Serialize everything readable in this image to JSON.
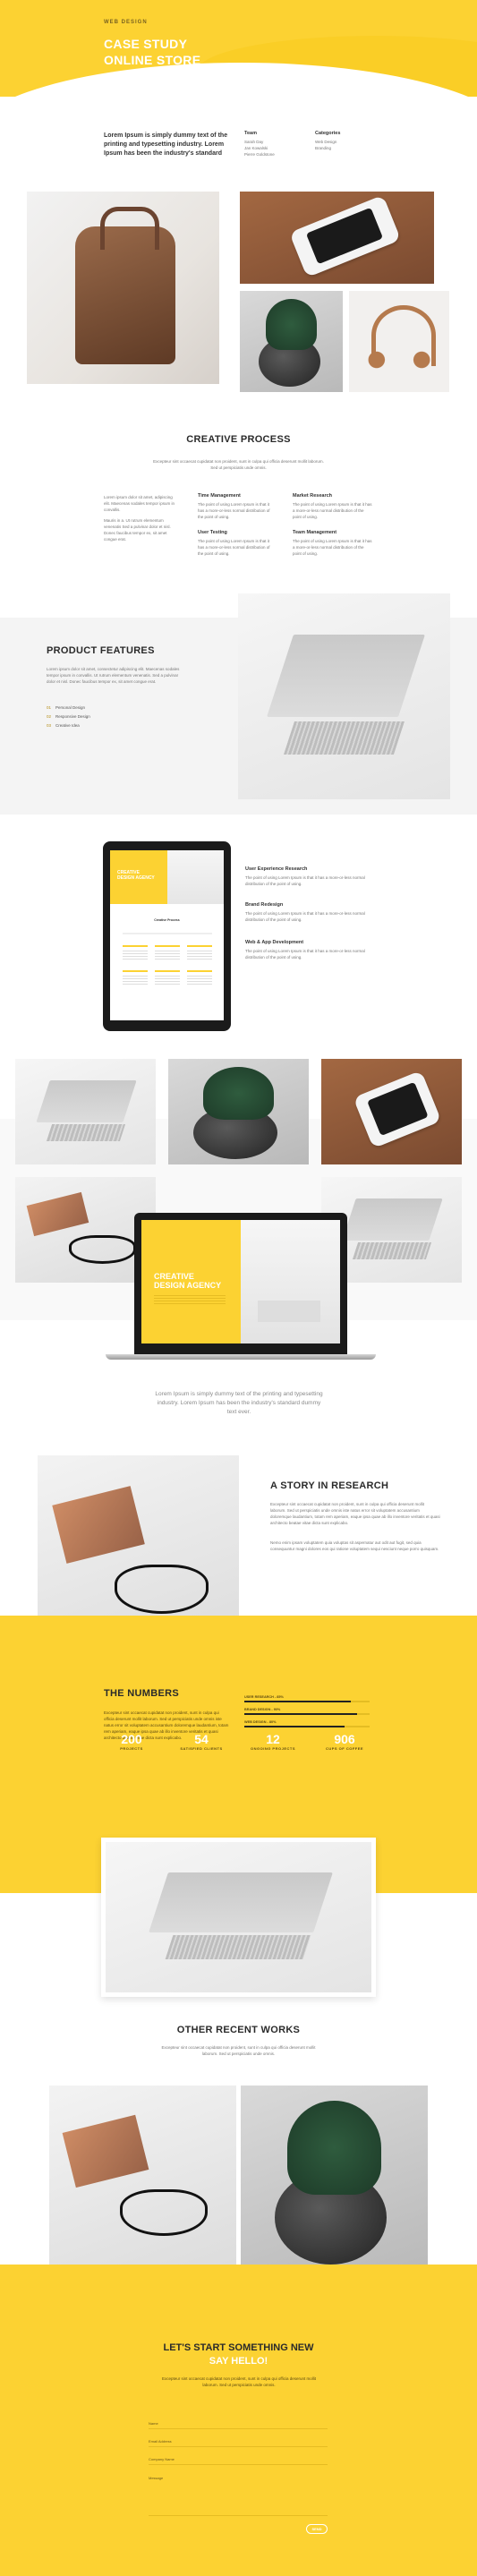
{
  "hero": {
    "eyebrow": "WEB DESIGN",
    "title_line1": "CASE STUDY",
    "title_line2": "ONLINE STORE"
  },
  "intro": {
    "lead": "Lorem Ipsum is simply dummy text of the printing and typesetting industry. Lorem Ipsum has been the industry's standard",
    "team_heading": "Team",
    "team_members": [
      "Sarah Day",
      "Jan Kowalski",
      "Pierre Goldstone"
    ],
    "categories_heading": "Categories",
    "categories": [
      "Web Design",
      "Branding"
    ]
  },
  "creative_process": {
    "title": "CREATIVE PROCESS",
    "subtitle": "Excepteur sint occaecat cupidatat non proident, sunt in culpa qui officia deserunt mollit laborum. Sed ut perspiciatis unde omnis.",
    "left_text_1": "Lorem ipsum dolor sit amet, adipiscing elit. Maecenas sodales tempor ipsum in convallis.",
    "left_text_2": "Mauris in a. Ut rutrum elementum venenatis Sed a pulvinar dolor et nisl. Donec faucibus tempor ex, sit amet congue erat.",
    "items": [
      {
        "title": "Time Management",
        "text": "The point of using Lorem Ipsum is that it has a more-or-less normal distribution of the point of using."
      },
      {
        "title": "Market Research",
        "text": "The point of using Lorem Ipsum is that it has a more-or-less normal distribution of the point of using."
      },
      {
        "title": "User Testing",
        "text": "The point of using Lorem Ipsum is that it has a more-or-less normal distribution of the point of using."
      },
      {
        "title": "Team Management",
        "text": "The point of using Lorem Ipsum is that it has a more-or-less normal distribution of the point of using."
      }
    ]
  },
  "product_features": {
    "title": "PRODUCT FEATURES",
    "text": "Lorem ipsum dolor sit amet, consectetur adipiscing elit. Maecenas sodales tempor ipsum in convallis. Ut rutrum elementum venenatis. Sed a pulvinar dolor et nisl. Donec faucibus tempor ex, sit amet congue erat.",
    "list": [
      {
        "num": "01",
        "label": "Personal Design"
      },
      {
        "num": "02",
        "label": "Responsive Design"
      },
      {
        "num": "03",
        "label": "Creative Idea"
      }
    ]
  },
  "services": [
    {
      "title": "User Experience Research",
      "text": "The point of using Lorem Ipsum is that it has a more-or-less normal distribution of the point of using."
    },
    {
      "title": "Brand Redesign",
      "text": "The point of using Lorem Ipsum is that it has a more-or-less normal distribution of the point of using."
    },
    {
      "title": "Web & App Development",
      "text": "The point of using Lorem Ipsum is that it has a more-or-less normal distribution of the point of using."
    }
  ],
  "tablet_screen": {
    "heading_line1": "CREATIVE",
    "heading_line2": "DESIGN AGENCY",
    "section": "Creative Process"
  },
  "laptop_screen": {
    "heading_line1": "CREATIVE",
    "heading_line2": "DESIGN AGENCY"
  },
  "quote": "Lorem Ipsum is simply dummy text of the printing and typesetting industry. Lorem Ipsum has been the industry's standard dummy text ever.",
  "story": {
    "title": "A STORY IN RESEARCH",
    "p1": "Excepteur sint occaecat cupidatat non proident, sunt in culpa qui officia deserunt mollit laborum. Sed ut perspiciatis unde omnis iste natus error sit voluptatem accusantium doloremque laudantium, totam rem aperiam, eaque ipsa quae ab illo inventore veritatis et quasi architecto beatae vitae dicta sunt explicabo.",
    "p2": "Nemo enim ipsam voluptatem quia voluptas sit aspernatur aut odit aut fugit, sed quia consequuntur magni dolores eos qui ratione voluptatem sequi nesciunt neque porro quisquam."
  },
  "numbers": {
    "title": "THE NUMBERS",
    "text": "Excepteur sint occaecat cupidatat non proident, sunt in culpa qui officia deserunt mollit laborum. Sed ut perspiciatis unde omnis iste natus error sit voluptatem accusantium doloremque laudantium, totam rem aperiam, eaque ipsa quae ab illo inventore veritatis et quasi architecto beatae vitae dicta sunt explicabo.",
    "skills": [
      {
        "label": "USER RESEARCH - 85%",
        "value": 0.85
      },
      {
        "label": "BRAND DESIGN - 90%",
        "value": 0.9
      },
      {
        "label": "WEB DESIGN - 80%",
        "value": 0.8
      }
    ],
    "stats": [
      {
        "value": "200",
        "label": "PROJECTS"
      },
      {
        "value": "54",
        "label": "SATISFIED CLIENTS"
      },
      {
        "value": "12",
        "label": "ONGOING PROJECTS"
      },
      {
        "value": "906",
        "label": "CUPS OF COFFEE"
      }
    ]
  },
  "other_works": {
    "title": "OTHER RECENT WORKS",
    "subtitle": "Excepteur sint occaecat cupidatat non proident, sunt in culpa qui officia deserunt mollit laborum. Sed ut perspiciatis unde omnis."
  },
  "contact": {
    "title_line1": "LET'S START SOMETHING NEW",
    "title_line2": "SAY HELLO!",
    "text": "Excepteur sint occaecat cupidatat non proident, sunt in culpa qui officia deserunt mollit laborum. Sed ut perspiciatis unde omnis.",
    "fields": [
      "Name",
      "Email Address",
      "Company Name",
      "Message"
    ],
    "submit": "SEND"
  },
  "colors": {
    "accent": "#fcd232",
    "text": "#333333",
    "light_bg": "#f4f4f4"
  }
}
